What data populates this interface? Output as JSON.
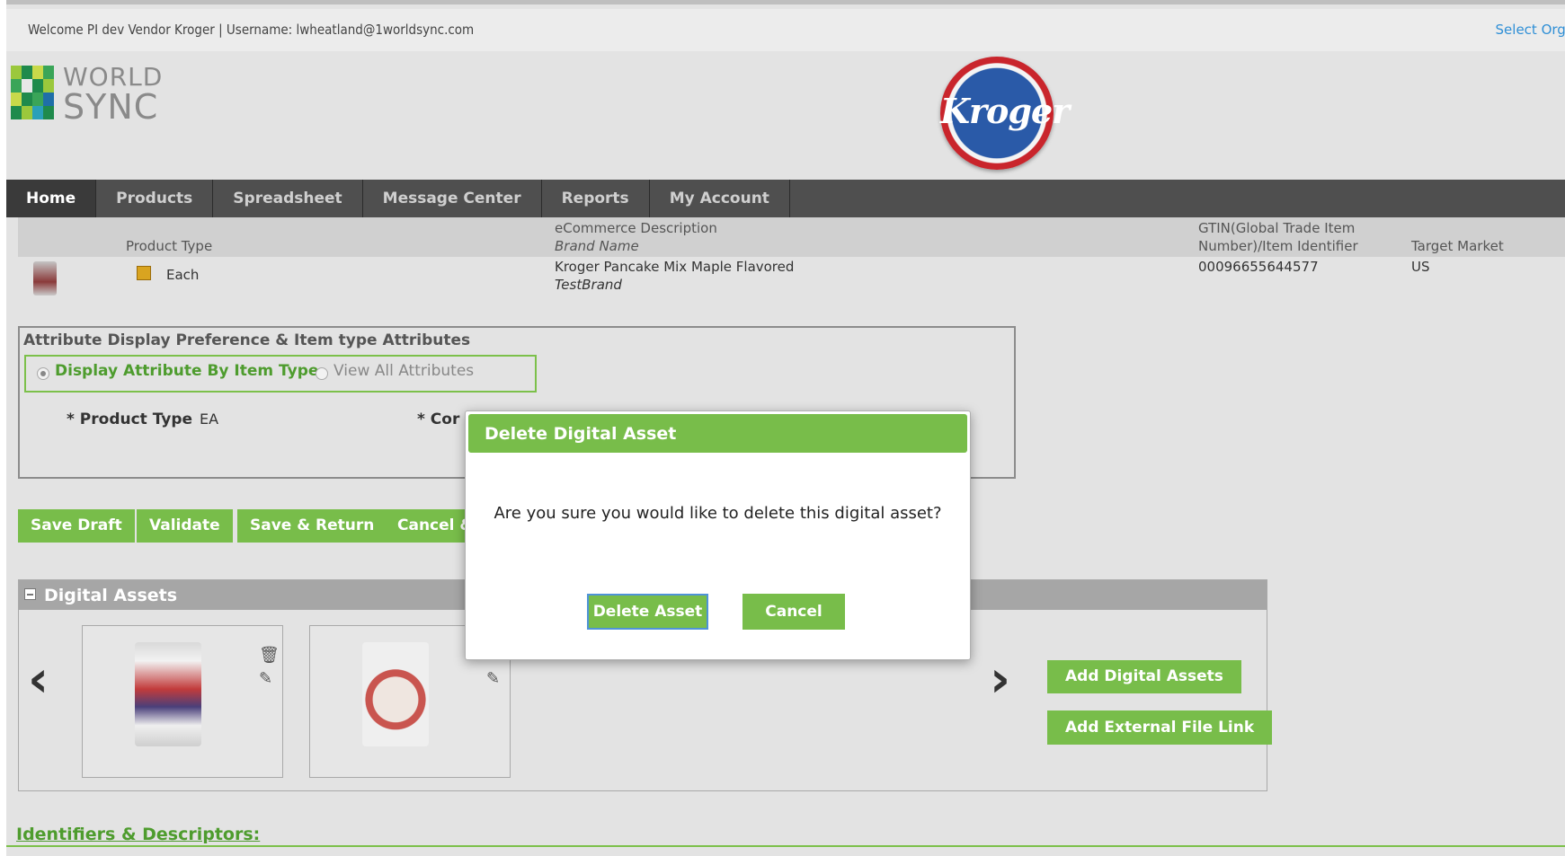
{
  "header": {
    "welcome": "Welcome PI dev Vendor Kroger | Username: lwheatland@1worldsync.com",
    "select_org": "Select Orga"
  },
  "logo": {
    "line1": "WORLD",
    "line2": "SYNC"
  },
  "partner_logo": {
    "text": "Kroger"
  },
  "nav": {
    "items": [
      {
        "label": "Home",
        "active": true
      },
      {
        "label": "Products"
      },
      {
        "label": "Spreadsheet"
      },
      {
        "label": "Message Center"
      },
      {
        "label": "Reports"
      },
      {
        "label": "My Account"
      }
    ]
  },
  "product_header": {
    "col_product_type": "Product Type",
    "col_ecom_desc": "eCommerce Description",
    "col_brand_name": "Brand Name",
    "col_gtin_1": "GTIN(Global Trade Item",
    "col_gtin_2": "Number)/Item Identifier",
    "col_target_market": "Target Market",
    "row": {
      "product_type": "Each",
      "ecom_desc": "Kroger Pancake Mix Maple Flavored",
      "brand_name": "TestBrand",
      "gtin": "00096655644577",
      "target_market": "US"
    }
  },
  "attributes": {
    "title": "Attribute Display Preference & Item type Attributes",
    "option_by_type": "Display Attribute By Item Type",
    "option_all": "View All Attributes",
    "product_type_label": "* Product Type",
    "product_type_value": "EA",
    "con_label": "* Cor"
  },
  "actions": {
    "save_draft": "Save Draft",
    "validate": "Validate",
    "save_return": "Save & Return",
    "cancel": "Cancel &"
  },
  "digital_assets": {
    "title": "Digital Assets",
    "add_assets": "Add Digital Assets",
    "add_link": "Add External File Link"
  },
  "identifiers": {
    "title": "Identifiers & Descriptors:"
  },
  "modal": {
    "title": "Delete Digital Asset",
    "message": "Are you sure you would like to delete this digital asset?",
    "confirm": "Delete Asset",
    "cancel": "Cancel"
  },
  "colors": {
    "accent": "#78bd4a",
    "nav_bg": "#4f4f4f",
    "link": "#2f8fd6"
  }
}
